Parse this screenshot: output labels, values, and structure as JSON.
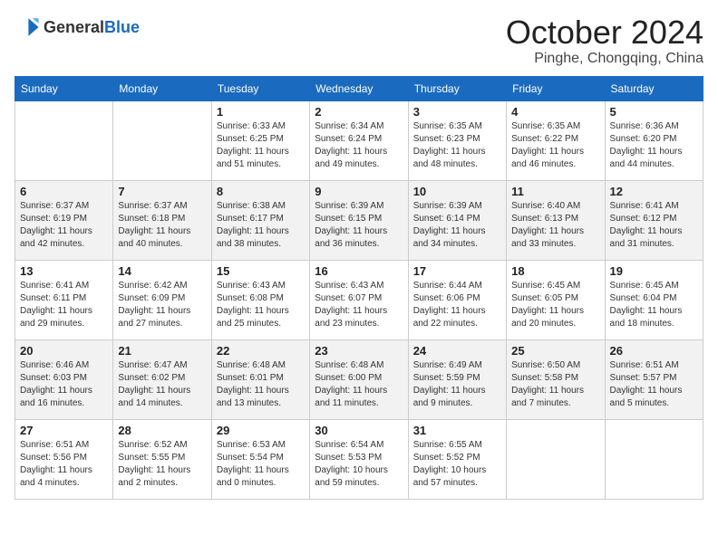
{
  "header": {
    "logo_general": "General",
    "logo_blue": "Blue",
    "month_title": "October 2024",
    "location": "Pinghe, Chongqing, China"
  },
  "columns": [
    "Sunday",
    "Monday",
    "Tuesday",
    "Wednesday",
    "Thursday",
    "Friday",
    "Saturday"
  ],
  "weeks": [
    [
      {
        "day": "",
        "info": ""
      },
      {
        "day": "",
        "info": ""
      },
      {
        "day": "1",
        "info": "Sunrise: 6:33 AM\nSunset: 6:25 PM\nDaylight: 11 hours and 51 minutes."
      },
      {
        "day": "2",
        "info": "Sunrise: 6:34 AM\nSunset: 6:24 PM\nDaylight: 11 hours and 49 minutes."
      },
      {
        "day": "3",
        "info": "Sunrise: 6:35 AM\nSunset: 6:23 PM\nDaylight: 11 hours and 48 minutes."
      },
      {
        "day": "4",
        "info": "Sunrise: 6:35 AM\nSunset: 6:22 PM\nDaylight: 11 hours and 46 minutes."
      },
      {
        "day": "5",
        "info": "Sunrise: 6:36 AM\nSunset: 6:20 PM\nDaylight: 11 hours and 44 minutes."
      }
    ],
    [
      {
        "day": "6",
        "info": "Sunrise: 6:37 AM\nSunset: 6:19 PM\nDaylight: 11 hours and 42 minutes."
      },
      {
        "day": "7",
        "info": "Sunrise: 6:37 AM\nSunset: 6:18 PM\nDaylight: 11 hours and 40 minutes."
      },
      {
        "day": "8",
        "info": "Sunrise: 6:38 AM\nSunset: 6:17 PM\nDaylight: 11 hours and 38 minutes."
      },
      {
        "day": "9",
        "info": "Sunrise: 6:39 AM\nSunset: 6:15 PM\nDaylight: 11 hours and 36 minutes."
      },
      {
        "day": "10",
        "info": "Sunrise: 6:39 AM\nSunset: 6:14 PM\nDaylight: 11 hours and 34 minutes."
      },
      {
        "day": "11",
        "info": "Sunrise: 6:40 AM\nSunset: 6:13 PM\nDaylight: 11 hours and 33 minutes."
      },
      {
        "day": "12",
        "info": "Sunrise: 6:41 AM\nSunset: 6:12 PM\nDaylight: 11 hours and 31 minutes."
      }
    ],
    [
      {
        "day": "13",
        "info": "Sunrise: 6:41 AM\nSunset: 6:11 PM\nDaylight: 11 hours and 29 minutes."
      },
      {
        "day": "14",
        "info": "Sunrise: 6:42 AM\nSunset: 6:09 PM\nDaylight: 11 hours and 27 minutes."
      },
      {
        "day": "15",
        "info": "Sunrise: 6:43 AM\nSunset: 6:08 PM\nDaylight: 11 hours and 25 minutes."
      },
      {
        "day": "16",
        "info": "Sunrise: 6:43 AM\nSunset: 6:07 PM\nDaylight: 11 hours and 23 minutes."
      },
      {
        "day": "17",
        "info": "Sunrise: 6:44 AM\nSunset: 6:06 PM\nDaylight: 11 hours and 22 minutes."
      },
      {
        "day": "18",
        "info": "Sunrise: 6:45 AM\nSunset: 6:05 PM\nDaylight: 11 hours and 20 minutes."
      },
      {
        "day": "19",
        "info": "Sunrise: 6:45 AM\nSunset: 6:04 PM\nDaylight: 11 hours and 18 minutes."
      }
    ],
    [
      {
        "day": "20",
        "info": "Sunrise: 6:46 AM\nSunset: 6:03 PM\nDaylight: 11 hours and 16 minutes."
      },
      {
        "day": "21",
        "info": "Sunrise: 6:47 AM\nSunset: 6:02 PM\nDaylight: 11 hours and 14 minutes."
      },
      {
        "day": "22",
        "info": "Sunrise: 6:48 AM\nSunset: 6:01 PM\nDaylight: 11 hours and 13 minutes."
      },
      {
        "day": "23",
        "info": "Sunrise: 6:48 AM\nSunset: 6:00 PM\nDaylight: 11 hours and 11 minutes."
      },
      {
        "day": "24",
        "info": "Sunrise: 6:49 AM\nSunset: 5:59 PM\nDaylight: 11 hours and 9 minutes."
      },
      {
        "day": "25",
        "info": "Sunrise: 6:50 AM\nSunset: 5:58 PM\nDaylight: 11 hours and 7 minutes."
      },
      {
        "day": "26",
        "info": "Sunrise: 6:51 AM\nSunset: 5:57 PM\nDaylight: 11 hours and 5 minutes."
      }
    ],
    [
      {
        "day": "27",
        "info": "Sunrise: 6:51 AM\nSunset: 5:56 PM\nDaylight: 11 hours and 4 minutes."
      },
      {
        "day": "28",
        "info": "Sunrise: 6:52 AM\nSunset: 5:55 PM\nDaylight: 11 hours and 2 minutes."
      },
      {
        "day": "29",
        "info": "Sunrise: 6:53 AM\nSunset: 5:54 PM\nDaylight: 11 hours and 0 minutes."
      },
      {
        "day": "30",
        "info": "Sunrise: 6:54 AM\nSunset: 5:53 PM\nDaylight: 10 hours and 59 minutes."
      },
      {
        "day": "31",
        "info": "Sunrise: 6:55 AM\nSunset: 5:52 PM\nDaylight: 10 hours and 57 minutes."
      },
      {
        "day": "",
        "info": ""
      },
      {
        "day": "",
        "info": ""
      }
    ]
  ]
}
